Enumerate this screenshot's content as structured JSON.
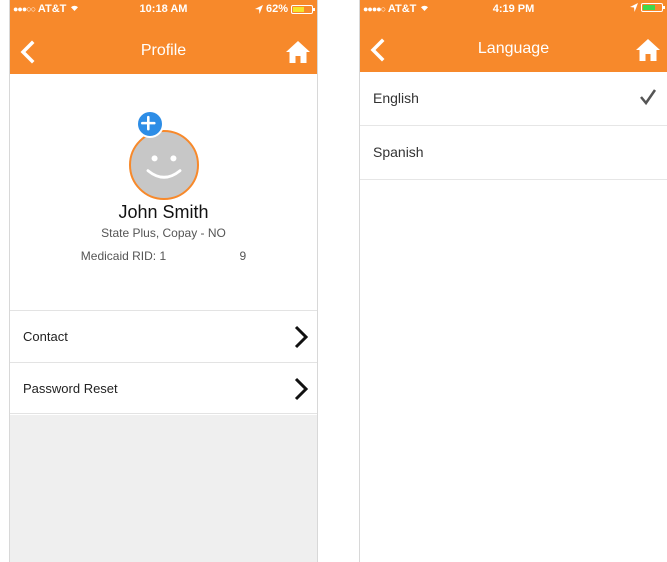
{
  "profile_screen": {
    "status": {
      "carrier": "AT&T",
      "time": "10:18 AM",
      "battery": "62%",
      "battery_level": 0.62
    },
    "title": "Profile",
    "user": {
      "name": "John Smith",
      "plan": "State Plus, Copay - NO",
      "rid_label": "Medicaid RID: 1",
      "rid_suffix": "9"
    },
    "rows": [
      {
        "label": "Contact"
      },
      {
        "label": "Password Reset"
      }
    ]
  },
  "language_screen": {
    "status": {
      "carrier": "AT&T",
      "time": "4:19 PM",
      "battery_level": 0.65
    },
    "title": "Language",
    "options": [
      {
        "label": "English",
        "selected": true
      },
      {
        "label": "Spanish",
        "selected": false
      }
    ]
  },
  "colors": {
    "accent": "#f7892b",
    "plus": "#2d8de6",
    "avatar": "#c7c7c7"
  },
  "icons": [
    "back-chevron-icon",
    "home-icon",
    "chevron-right-icon",
    "checkmark-icon",
    "add-photo-icon",
    "wifi-icon",
    "location-icon",
    "battery-icon"
  ]
}
